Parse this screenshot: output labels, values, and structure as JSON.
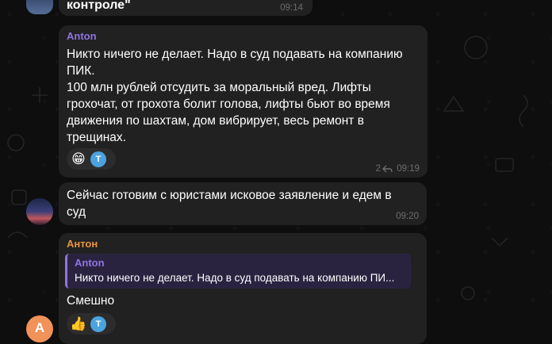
{
  "messages": [
    {
      "text": "контроле\"",
      "time": "09:14"
    },
    {
      "sender": "Anton",
      "sender_color": "#8f74e3",
      "text": "Никто ничего не делает. Надо в суд подавать на компанию ПИК.\n100 млн рублей отсудить за моральный вред. Лифты грохочат, от грохота болит голова, лифты бьют во время движения по шахтам, дом вибрирует, весь ремонт в трещинах.",
      "reactions": [
        {
          "emoji": "😁",
          "reactor": "T"
        }
      ],
      "reply_count": "2",
      "time": "09:19"
    },
    {
      "text": "Сейчас готовим с юристами исковое заявление и едем в суд",
      "time": "09:20"
    },
    {
      "sender": "Антон",
      "sender_color": "#e7963b",
      "quote": {
        "sender": "Anton",
        "text": "Никто ничего не делает. Надо в суд подавать на компанию ПИ..."
      },
      "text": "Смешно",
      "reactions": [
        {
          "emoji": "👍",
          "reactor": "T"
        }
      ],
      "avatar_letter": "А"
    }
  ],
  "colors": {
    "bubble": "#212121",
    "background": "#0e0e0e",
    "quote_bg": "#2a2340",
    "avatar_orange": "#f0925a",
    "reactor_blue": "#4aa3df"
  }
}
